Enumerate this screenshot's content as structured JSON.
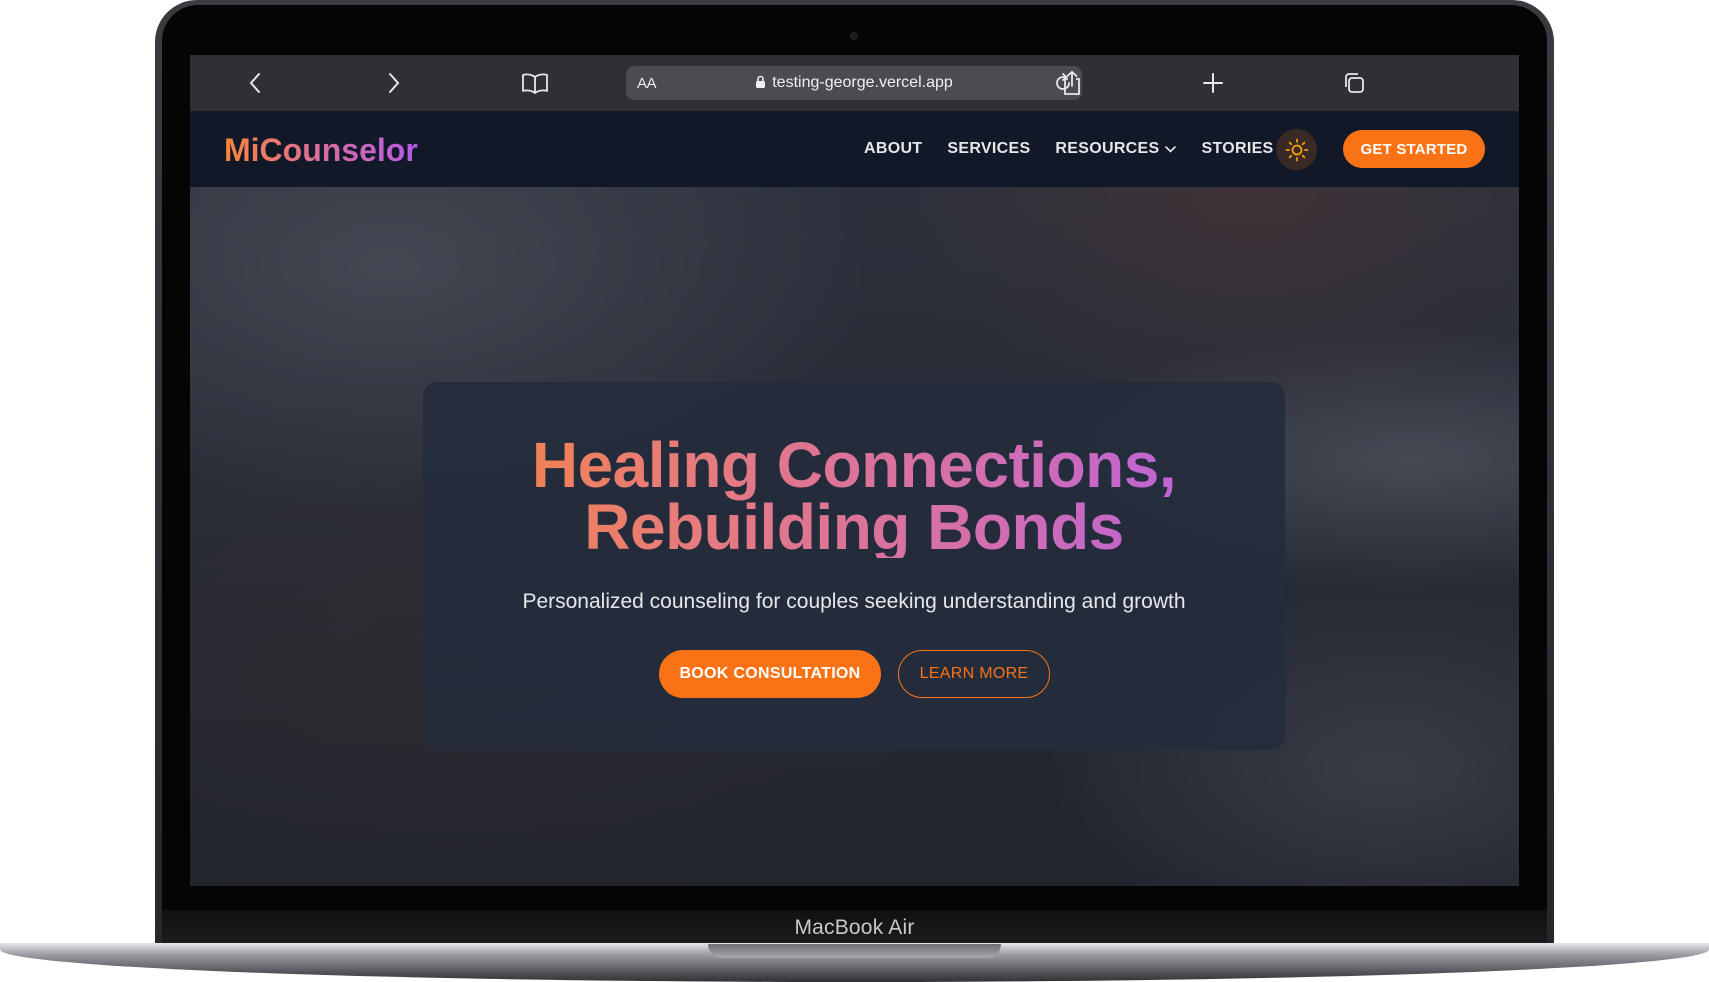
{
  "device": {
    "label": "MacBook Air"
  },
  "browser": {
    "text_size_label": "AA",
    "url": "testing-george.vercel.app",
    "icons": [
      "back-icon",
      "forward-icon",
      "bookmarks-icon",
      "lock-icon",
      "reload-icon",
      "share-icon",
      "new-tab-icon",
      "tabs-icon"
    ]
  },
  "site": {
    "logo": "MiCounselor",
    "nav": {
      "items": [
        {
          "label": "ABOUT"
        },
        {
          "label": "SERVICES"
        },
        {
          "label": "RESOURCES"
        },
        {
          "label": "STORIES"
        }
      ],
      "cta_label": "GET STARTED"
    },
    "hero": {
      "headline_line1": "Healing Connections,",
      "headline_line2": "Rebuilding Bonds",
      "subtitle": "Personalized counseling for couples seeking understanding and growth",
      "primary_button": "BOOK CONSULTATION",
      "secondary_button": "LEARN MORE"
    },
    "colors": {
      "accent": "#f97316",
      "nav_bg": "#111827",
      "gradient_start": "#f7863a",
      "gradient_end": "#b35ee8"
    }
  }
}
